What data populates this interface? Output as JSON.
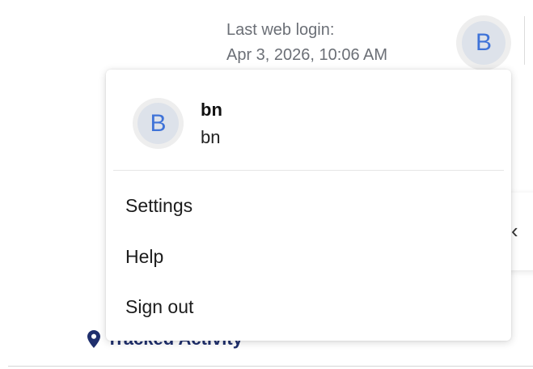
{
  "header": {
    "last_login_label": "Last web login:",
    "last_login_value": "Apr 3, 2026, 10:06 AM",
    "avatar_initial": "B"
  },
  "user_menu": {
    "avatar_initial": "B",
    "name": "bn",
    "email": "bn",
    "items": [
      {
        "label": "Settings",
        "icon": "none"
      },
      {
        "label": "Help",
        "icon": "none"
      },
      {
        "label": "Sign out",
        "icon": "none"
      }
    ]
  },
  "background": {
    "tracked_label": "Tracked Activity",
    "tracked_icon": "map-pin-icon",
    "chevron_icon": "chevron-left-icon"
  },
  "colors": {
    "avatar_text": "#3f73d8",
    "avatar_bg": "#dde2ea",
    "tracked_text": "#1f2f6d"
  }
}
